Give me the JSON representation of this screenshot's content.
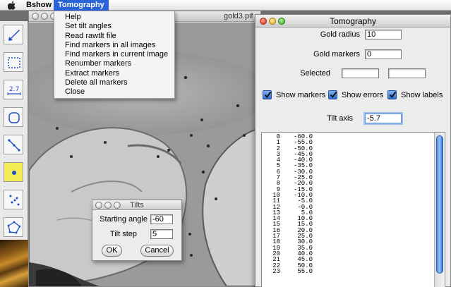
{
  "menubar": {
    "apple_icon": "apple-icon",
    "items": [
      "Bshow",
      "Tomography"
    ]
  },
  "tomography_menu": {
    "items": [
      "Help",
      "Set tilt angles",
      "Read rawtlt file",
      "Find markers in all images",
      "Find markers in current image",
      "Renumber markers",
      "Extract markers",
      "Delete all markers",
      "Close"
    ]
  },
  "tools": [
    "arrow-tool-icon",
    "rectangle-select-icon",
    "measure-text-icon",
    "circle-select-icon",
    "line-tool-icon",
    "marker-point-icon",
    "scatter-points-icon",
    "polygon-tool-icon"
  ],
  "image_window": {
    "title": "gold3.pif"
  },
  "tomography_window": {
    "title": "Tomography",
    "gold_radius_label": "Gold radius",
    "gold_radius_value": "10",
    "gold_markers_label": "Gold markers",
    "gold_markers_value": "0",
    "selected_label": "Selected",
    "selected_value_1": "",
    "selected_value_2": "",
    "checkboxes": [
      {
        "label": "Show markers",
        "checked": true
      },
      {
        "label": "Show errors",
        "checked": true
      },
      {
        "label": "Show labels",
        "checked": true
      }
    ],
    "tilt_axis_label": "Tilt axis",
    "tilt_axis_value": "-5.7",
    "tilt_list": [
      {
        "index": "0",
        "angle": "-60.0"
      },
      {
        "index": "1",
        "angle": "-55.0"
      },
      {
        "index": "2",
        "angle": "-50.0"
      },
      {
        "index": "3",
        "angle": "-45.0"
      },
      {
        "index": "4",
        "angle": "-40.0"
      },
      {
        "index": "5",
        "angle": "-35.0"
      },
      {
        "index": "6",
        "angle": "-30.0"
      },
      {
        "index": "7",
        "angle": "-25.0"
      },
      {
        "index": "8",
        "angle": "-20.0"
      },
      {
        "index": "9",
        "angle": "-15.0"
      },
      {
        "index": "10",
        "angle": "-10.0"
      },
      {
        "index": "11",
        "angle": "-5.0"
      },
      {
        "index": "12",
        "angle": "-0.0"
      },
      {
        "index": "13",
        "angle": "5.0"
      },
      {
        "index": "14",
        "angle": "10.0"
      },
      {
        "index": "15",
        "angle": "15.0"
      },
      {
        "index": "16",
        "angle": "20.0"
      },
      {
        "index": "17",
        "angle": "25.0"
      },
      {
        "index": "18",
        "angle": "30.0"
      },
      {
        "index": "19",
        "angle": "35.0"
      },
      {
        "index": "20",
        "angle": "40.0"
      },
      {
        "index": "21",
        "angle": "45.0"
      },
      {
        "index": "22",
        "angle": "50.0"
      },
      {
        "index": "23",
        "angle": "55.0"
      }
    ]
  },
  "tilts_dialog": {
    "title": "Tilts",
    "starting_angle_label": "Starting angle",
    "starting_angle_value": "-60",
    "tilt_step_label": "Tilt step",
    "tilt_step_value": "5",
    "ok_label": "OK",
    "cancel_label": "Cancel"
  },
  "colors": {
    "menu_highlight": "#2a63d6",
    "selected_tool": "#f4ec55",
    "checkbox_blue": "#2d6fd0"
  }
}
